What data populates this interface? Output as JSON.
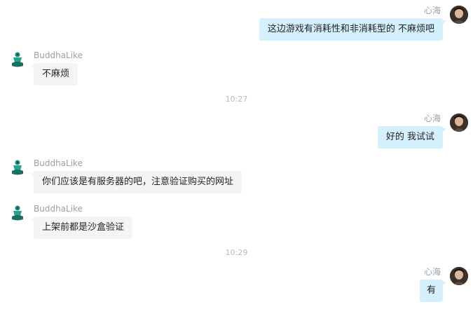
{
  "messages": [
    {
      "sender": "心海",
      "side": "right",
      "text": "这边游戏有消耗性和非消耗型的 不麻烦吧"
    },
    {
      "sender": "BuddhaLike",
      "side": "left",
      "text": "不麻烦"
    },
    {
      "time": "10:27"
    },
    {
      "sender": "心海",
      "side": "right",
      "text": "好的 我试试"
    },
    {
      "sender": "BuddhaLike",
      "side": "left",
      "text": "你们应该是有服务器的吧，注意验证购买的网址"
    },
    {
      "sender": "BuddhaLike",
      "side": "left",
      "text": "上架前都是沙盒验证"
    },
    {
      "time": "10:29"
    },
    {
      "sender": "心海",
      "side": "right",
      "text": "有"
    }
  ]
}
